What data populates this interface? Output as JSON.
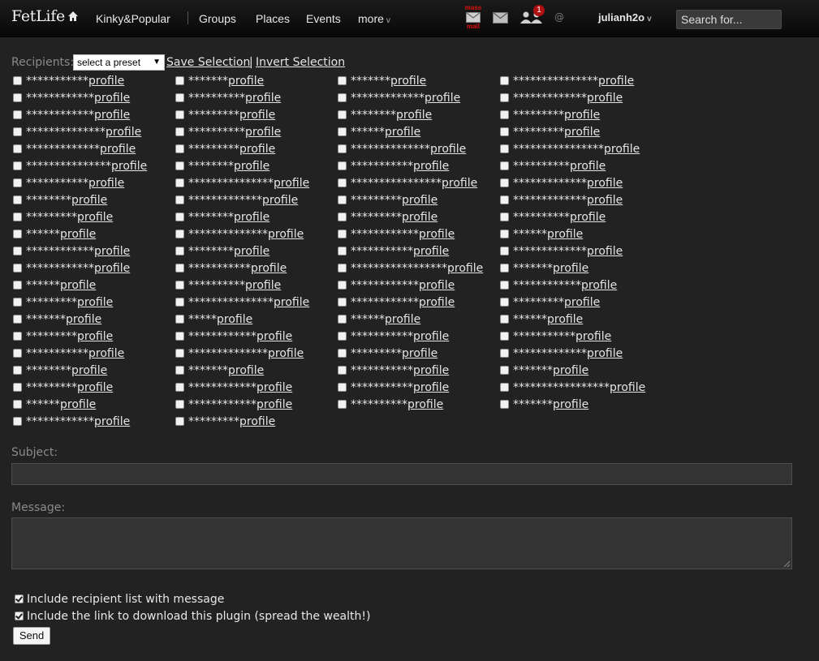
{
  "nav": {
    "logo": "FetLife",
    "items": [
      "Kinky&Popular",
      "Groups",
      "Places",
      "Events",
      "more"
    ],
    "mass_mail_top": "mass",
    "mass_mail_bottom": "mail",
    "notification_count": "1",
    "at_symbol": "@",
    "username": "julianh2o",
    "search_placeholder": "Search for..."
  },
  "recipients": {
    "label": "Recipients:",
    "preset_value": "select a preset",
    "save_label": "Save Selection",
    "separator": "|",
    "invert_label": "Invert Selection",
    "link_text": "profile",
    "columns": [
      [
        "***********",
        "************",
        "************",
        "**************",
        "*************",
        "***************",
        "***********",
        "********",
        "*********",
        "******",
        "************",
        "************",
        "******",
        "*********",
        "*******",
        "*********",
        "***********",
        "********",
        "*********",
        "******",
        "************"
      ],
      [
        "*******",
        "**********",
        "*********",
        "**********",
        "*********",
        "********",
        "***************",
        "*************",
        "********",
        "**************",
        "********",
        "***********",
        "**********",
        "***************",
        "*****",
        "************",
        "**************",
        "*******",
        "************",
        "************",
        "*********"
      ],
      [
        "*******",
        "*************",
        "********",
        "******",
        "**************",
        "***********",
        "****************",
        "*********",
        "*********",
        "************",
        "***********",
        "*****************",
        "************",
        "************",
        "******",
        "***********",
        "*********",
        "***********",
        "***********",
        "**********"
      ],
      [
        "***************",
        "*************",
        "*********",
        "*********",
        "****************",
        "**********",
        "*************",
        "*************",
        "**********",
        "******",
        "*************",
        "*******",
        "************",
        "*********",
        "******",
        "***********",
        "*************",
        "*******",
        "*****************",
        "*******"
      ]
    ]
  },
  "subject": {
    "label": "Subject:",
    "value": ""
  },
  "message": {
    "label": "Message:",
    "value": ""
  },
  "options": {
    "include_list": "Include recipient list with message",
    "include_link": "Include the link to download this plugin (spread the wealth!)"
  },
  "send_label": "Send"
}
